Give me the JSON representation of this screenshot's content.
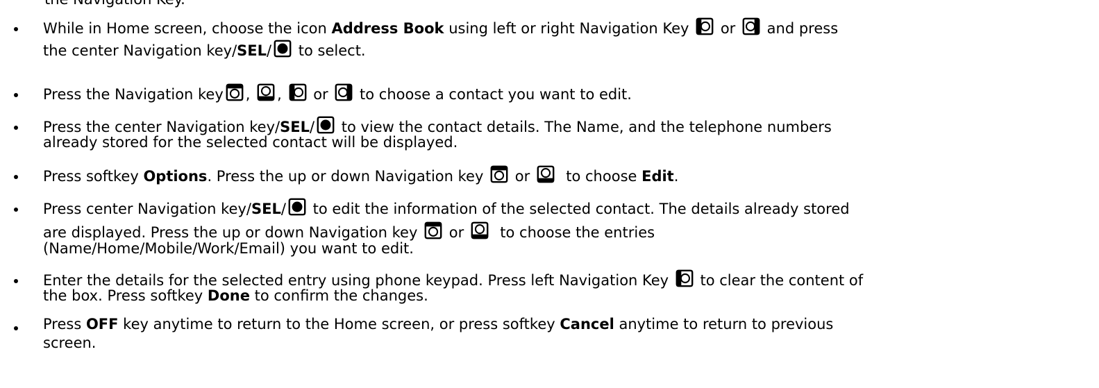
{
  "header_fragment": "the Navigation Key.",
  "steps": [
    {
      "p1": "While in Home screen, choose the icon ",
      "b1": "Address Book",
      "p2": " using left or right Navigation Key ",
      "p3": " or ",
      "p4": " and press",
      "p5": "the center Navigation key/",
      "b2": "SEL",
      "p6": "/",
      "p7": " to select."
    },
    {
      "p1": "Press the Navigation key",
      "p2": ", ",
      "p3": ", ",
      "p4": " or ",
      "p5": " to choose a contact you want to edit."
    },
    {
      "p1": "Press the center Navigation key/",
      "b1": "SEL",
      "p2": "/",
      "p3": " to view the contact details. The Name, and the telephone numbers",
      "p4": "already stored for the selected contact will be displayed."
    },
    {
      "p1": "Press softkey ",
      "b1": "Options",
      "p2": ". Press the up or down Navigation key ",
      "p3": " or ",
      "p4": "  to choose ",
      "b2": "Edit",
      "p5": "."
    },
    {
      "p1": "Press center Navigation key/",
      "b1": "SEL",
      "p2": "/",
      "p3": " to edit the information of the selected contact. The details already stored",
      "p4": "are displayed. Press the up or down Navigation key ",
      "p5": " or ",
      "p6": "  to choose the entries",
      "p7": "(Name/Home/Mobile/Work/Email) you want to edit."
    },
    {
      "p1": "Enter the details for the selected entry using phone keypad. Press left Navigation Key ",
      "p2": " to clear the content of",
      "p3": "the box. Press softkey ",
      "b1": "Done",
      "p4": " to confirm the changes."
    },
    {
      "p1": "Press ",
      "b1": "OFF",
      "p2": " key anytime to return to the Home screen, or press softkey ",
      "b2": "Cancel",
      "p3": " anytime to return to previous",
      "p4": "screen."
    }
  ],
  "icons": {
    "up": "nav-up-key-icon",
    "down": "nav-down-key-icon",
    "left": "nav-left-key-icon",
    "right": "nav-right-key-icon",
    "center": "nav-center-key-icon"
  }
}
